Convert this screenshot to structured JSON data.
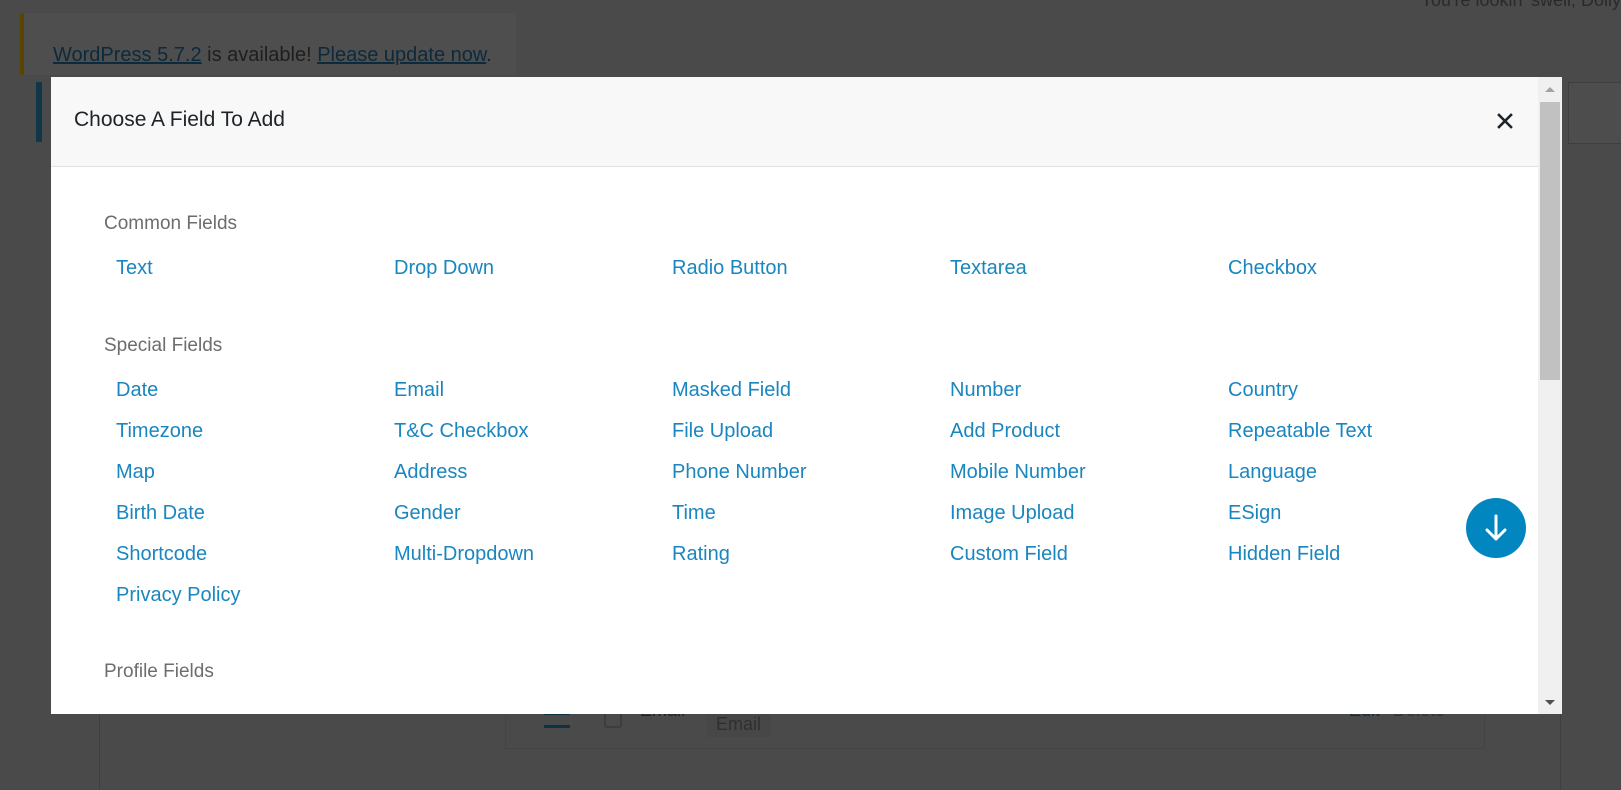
{
  "background": {
    "greeting": "You're lookin' swell, Dolly",
    "notice": {
      "link1": "WordPress 5.7.2",
      "middle": " is available! ",
      "link2": "Please update now",
      "end": "."
    },
    "row": {
      "label": "Email",
      "tag": "Email",
      "edit": "Edit",
      "delete": "Delete"
    }
  },
  "modal": {
    "title": "Choose A Field To Add",
    "close_icon": "close-icon",
    "scroll_down_icon": "arrow-down-icon",
    "accent_color": "#0286bf",
    "link_color": "#1a86c0",
    "sections": [
      {
        "title": "Common Fields",
        "fields": [
          "Text",
          "Drop Down",
          "Radio Button",
          "Textarea",
          "Checkbox"
        ]
      },
      {
        "title": "Special Fields",
        "fields": [
          "Date",
          "Email",
          "Masked Field",
          "Number",
          "Country",
          "Timezone",
          "T&C Checkbox",
          "File Upload",
          "Add Product",
          "Repeatable Text",
          "Map",
          "Address",
          "Phone Number",
          "Mobile Number",
          "Language",
          "Birth Date",
          "Gender",
          "Time",
          "Image Upload",
          "ESign",
          "Shortcode",
          "Multi-Dropdown",
          "Rating",
          "Custom Field",
          "Hidden Field",
          "Privacy Policy"
        ]
      },
      {
        "title": "Profile Fields",
        "fields": []
      }
    ]
  }
}
